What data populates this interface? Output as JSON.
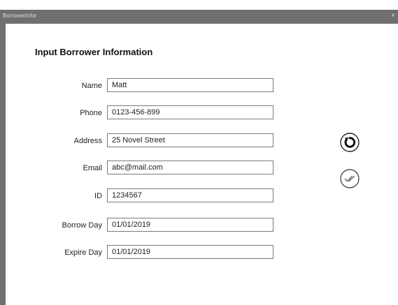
{
  "window": {
    "title": "BorrowerInfor",
    "close_glyph": "×"
  },
  "form": {
    "heading": "Input Borrower Information",
    "fields": [
      {
        "label": "Name",
        "value": "Matt"
      },
      {
        "label": "Phone",
        "value": "0123-456-899"
      },
      {
        "label": "Address",
        "value": "25 Novel Street"
      },
      {
        "label": "Email",
        "value": "abc@mail.com"
      },
      {
        "label": "ID",
        "value": "1234567"
      },
      {
        "label": "Borrow Day",
        "value": "01/01/2019"
      },
      {
        "label": "Expire Day",
        "value": "01/01/2019"
      }
    ]
  },
  "actions": {
    "reset_icon": "refresh-icon",
    "confirm_icon": "double-check-icon"
  }
}
